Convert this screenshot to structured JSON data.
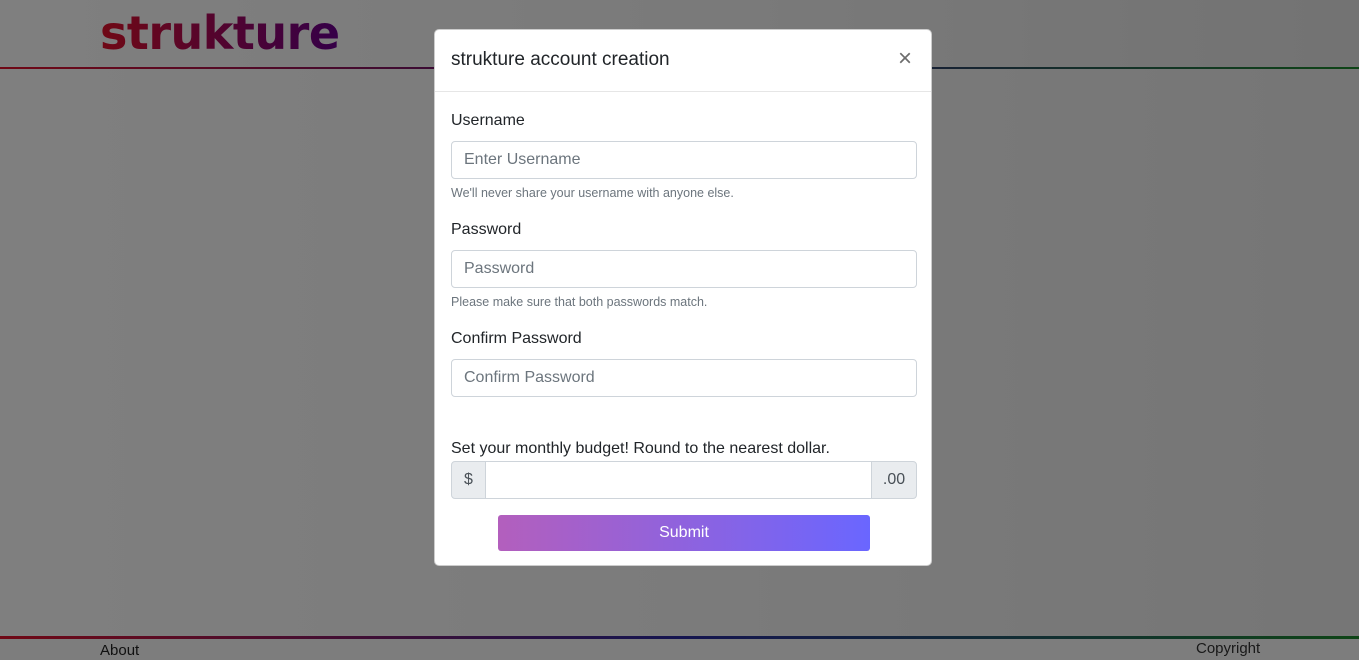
{
  "brand": {
    "name": "strukture"
  },
  "footer": {
    "about_label": "About",
    "copyright_label": "Copyright"
  },
  "modal": {
    "title": "strukture account creation",
    "close_label": "×",
    "username": {
      "label": "Username",
      "placeholder": "Enter Username",
      "value": "",
      "help": "We'll never share your username with anyone else."
    },
    "password": {
      "label": "Password",
      "placeholder": "Password",
      "value": "",
      "help": "Please make sure that both passwords match."
    },
    "confirm_password": {
      "label": "Confirm Password",
      "placeholder": "Confirm Password",
      "value": ""
    },
    "budget": {
      "label": "Set your monthly budget! Round to the nearest dollar.",
      "prefix": "$",
      "suffix": ".00",
      "value": ""
    },
    "submit_label": "Submit"
  },
  "colors": {
    "brand_start": "#e0112b",
    "brand_end": "#6a0090",
    "submit_start": "#b35fbd",
    "submit_end": "#6a66ff"
  }
}
